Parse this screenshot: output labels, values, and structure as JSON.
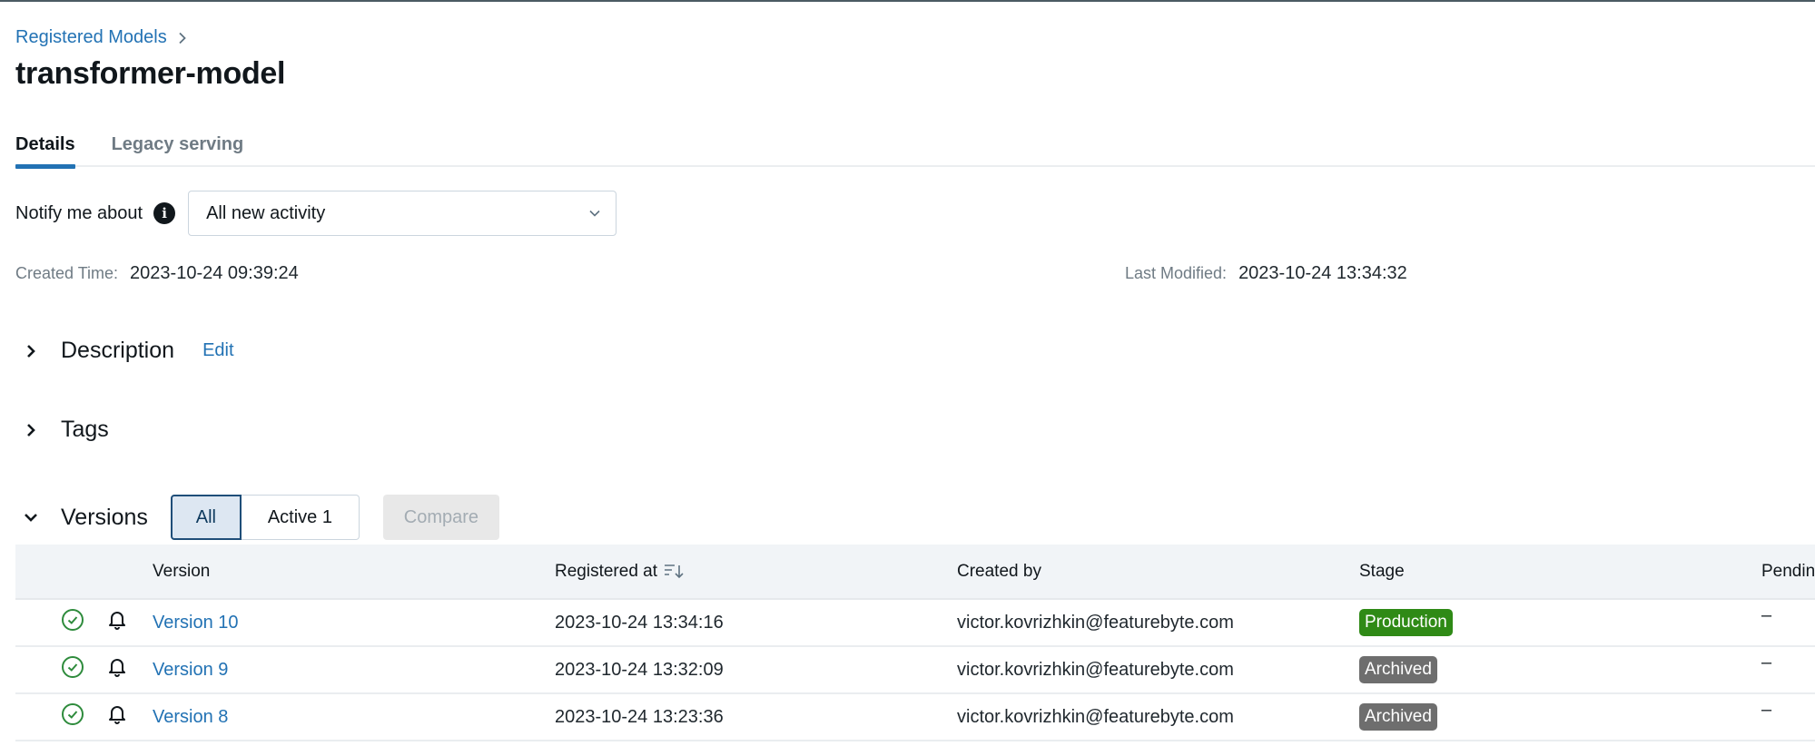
{
  "breadcrumb": {
    "parent": "Registered Models"
  },
  "page": {
    "title": "transformer-model"
  },
  "tabs": [
    {
      "label": "Details",
      "active": true
    },
    {
      "label": "Legacy serving",
      "active": false
    }
  ],
  "notify": {
    "label": "Notify me about",
    "info_icon": "info-icon",
    "selected": "All new activity"
  },
  "meta": {
    "created_label": "Created Time:",
    "created_value": "2023-10-24 09:39:24",
    "modified_label": "Last Modified:",
    "modified_value": "2023-10-24 13:34:32"
  },
  "sections": {
    "description": {
      "title": "Description",
      "edit_label": "Edit",
      "expanded": false
    },
    "tags": {
      "title": "Tags",
      "expanded": false
    },
    "versions": {
      "title": "Versions",
      "expanded": true,
      "filter_all": "All",
      "filter_active": "Active 1",
      "compare_label": "Compare"
    }
  },
  "table": {
    "columns": [
      "",
      "",
      "Version",
      "Registered at",
      "Created by",
      "Stage",
      "Pendin"
    ],
    "rows": [
      {
        "status_icon": "check-circle-icon",
        "bell_icon": "bell-icon",
        "version": "Version 10",
        "registered_at": "2023-10-24 13:34:16",
        "created_by": "victor.kovrizhkin@featurebyte.com",
        "stage": "Production",
        "pending": "–"
      },
      {
        "status_icon": "check-circle-icon",
        "bell_icon": "bell-icon",
        "version": "Version 9",
        "registered_at": "2023-10-24 13:32:09",
        "created_by": "victor.kovrizhkin@featurebyte.com",
        "stage": "Archived",
        "pending": "–"
      },
      {
        "status_icon": "check-circle-icon",
        "bell_icon": "bell-icon",
        "version": "Version 8",
        "registered_at": "2023-10-24 13:23:36",
        "created_by": "victor.kovrizhkin@featurebyte.com",
        "stage": "Archived",
        "pending": "–"
      }
    ]
  },
  "colors": {
    "accent": "#2272b4",
    "production_badge": "#2f8a16",
    "archived_badge": "#6e6e6e",
    "success_icon": "#2e8b3c"
  }
}
